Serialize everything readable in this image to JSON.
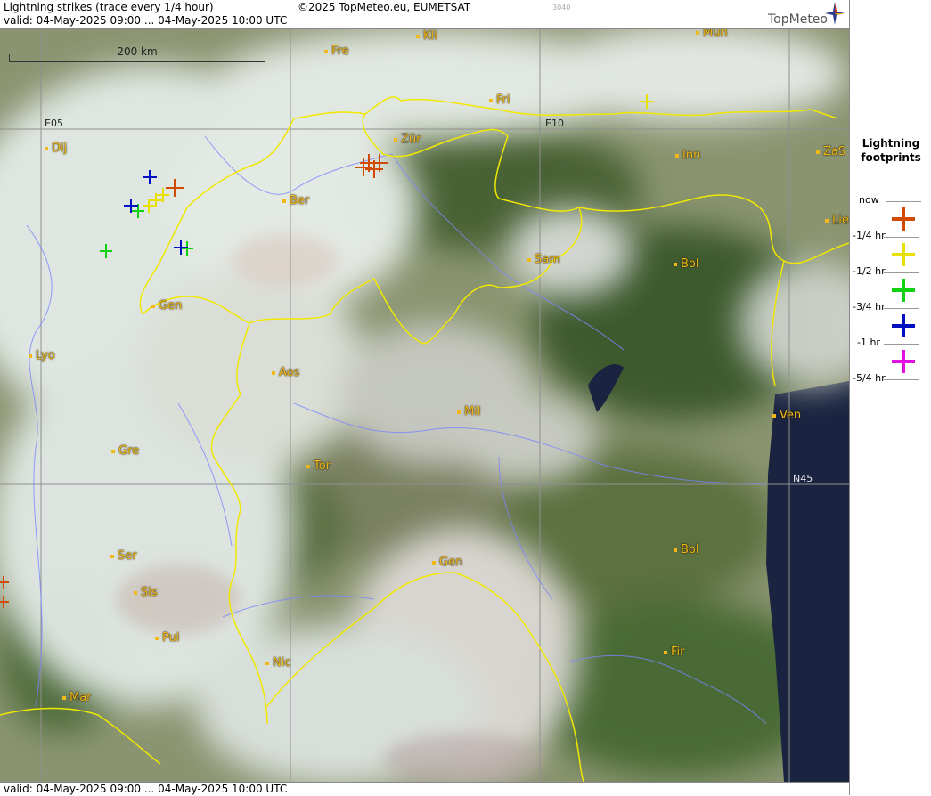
{
  "header": {
    "title": "Lightning strikes (trace every 1/4 hour)",
    "valid": "valid:  04-May-2025 09:00 ... 04-May-2025 10:00 UTC",
    "copyright": "©2025 TopMeteo.eu, EUMETSAT",
    "code": "3040",
    "logo": "TopMeteo"
  },
  "footer": {
    "valid": "valid:  04-May-2025 09:00 ... 04-May-2025 10:00 UTC"
  },
  "scale": {
    "label": "200 km"
  },
  "grid_labels": {
    "e05": "E05",
    "e10": "E10",
    "n45": "N45"
  },
  "places": [
    {
      "id": "kli",
      "name": "Kli"
    },
    {
      "id": "mun",
      "name": "Mun"
    },
    {
      "id": "fre",
      "name": "Fre"
    },
    {
      "id": "fri",
      "name": "Fri"
    },
    {
      "id": "dij",
      "name": "Dij"
    },
    {
      "id": "zur",
      "name": "Zür"
    },
    {
      "id": "inn",
      "name": "Inn"
    },
    {
      "id": "zas",
      "name": "ZaS"
    },
    {
      "id": "ber",
      "name": "Ber"
    },
    {
      "id": "lie",
      "name": "Lie"
    },
    {
      "id": "sam",
      "name": "Sam"
    },
    {
      "id": "bol1",
      "name": "Bol"
    },
    {
      "id": "gen1",
      "name": "Gen"
    },
    {
      "id": "lyo",
      "name": "Lyo"
    },
    {
      "id": "aos",
      "name": "Aos"
    },
    {
      "id": "mil",
      "name": "Mil"
    },
    {
      "id": "ven",
      "name": "Ven"
    },
    {
      "id": "gre",
      "name": "Gre"
    },
    {
      "id": "tor",
      "name": "Tor"
    },
    {
      "id": "ser",
      "name": "Ser"
    },
    {
      "id": "gen2",
      "name": "Gen"
    },
    {
      "id": "bol2",
      "name": "Bol"
    },
    {
      "id": "sis",
      "name": "Sis"
    },
    {
      "id": "pui",
      "name": "Pui"
    },
    {
      "id": "nic",
      "name": "Nic"
    },
    {
      "id": "fir",
      "name": "Fir"
    },
    {
      "id": "mar",
      "name": "Mar"
    }
  ],
  "legend": {
    "title_line1": "Lightning",
    "title_line2": "footprints",
    "rows": [
      {
        "label": "now",
        "color": ""
      },
      {
        "label": "-1/4 hr",
        "color": "#d04a00"
      },
      {
        "label": "-1/2 hr",
        "color": "#e8e000"
      },
      {
        "label": "-3/4 hr",
        "color": "#10d010"
      },
      {
        "label": "-1 hr",
        "color": "#0010c0"
      },
      {
        "label": "-5/4 hr",
        "color": "#e010e0"
      }
    ]
  },
  "colors": {
    "border": "#f0e800",
    "river": "#7a86ff",
    "strike_q1": "#d04a00",
    "strike_q2": "#e8e000",
    "strike_q3": "#10d010",
    "strike_q4": "#0010c0",
    "strike_q5": "#e010e0",
    "sea": "#1a2440"
  }
}
